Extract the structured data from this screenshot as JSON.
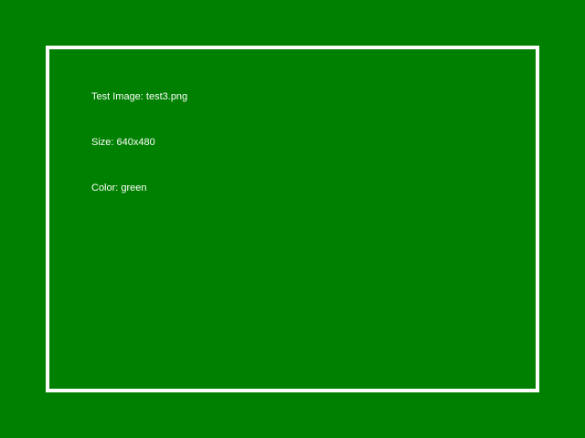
{
  "colors": {
    "background": "#008000",
    "border": "#ffffff",
    "text": "#ffffff"
  },
  "info": {
    "image_line": "Test Image: test3.png",
    "size_line": "Size: 640x480",
    "color_line": "Color: green"
  }
}
